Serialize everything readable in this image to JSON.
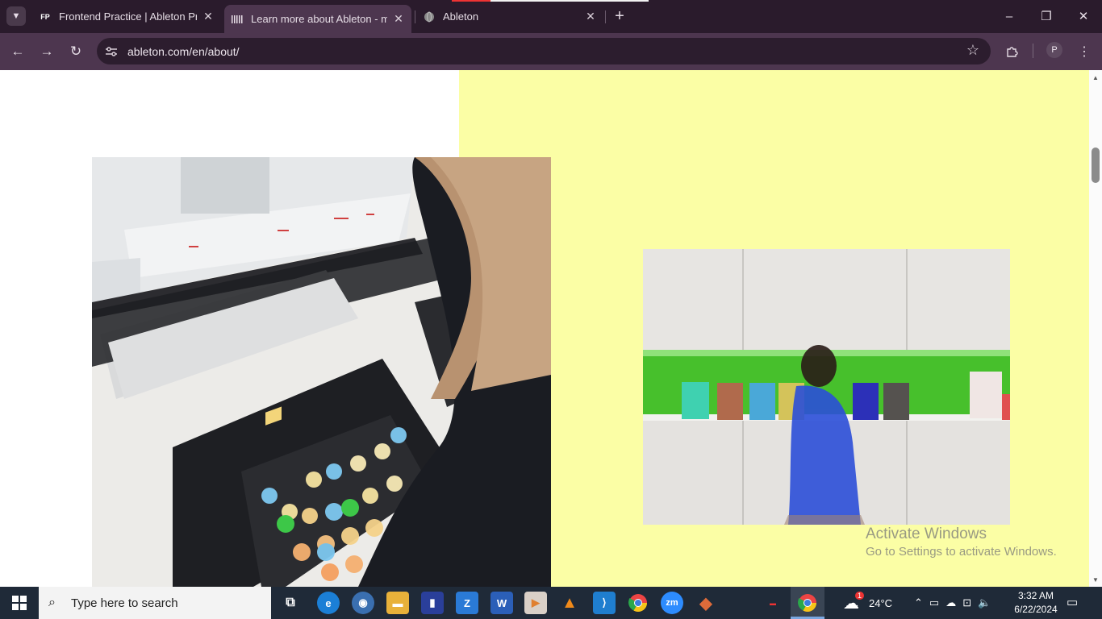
{
  "browser": {
    "tab_search_icon": "chevron-down-icon",
    "tabs": [
      {
        "title": "Frontend Practice | Ableton Pro",
        "favicon": "FP",
        "active": false
      },
      {
        "title": "Learn more about Ableton - ma",
        "favicon": "ableton-logo-icon",
        "active": true
      },
      {
        "title": "Ableton",
        "favicon": "globe-icon",
        "active": false
      }
    ],
    "new_tab_label": "+",
    "window_controls": {
      "minimize": "–",
      "restore": "❐",
      "close": "✕"
    },
    "url": "ableton.com/en/about/",
    "profile_initial": "P"
  },
  "page": {
    "yellow_color": "#fbfea5",
    "left_image_alt": "Person playing Ableton Push controller at a desk with computer",
    "right_image_alt": "Person walking past green bookshelf with Ableton books"
  },
  "watermark": {
    "line1": "Activate Windows",
    "line2": "Go to Settings to activate Windows."
  },
  "taskbar": {
    "search_placeholder": "Type here to search",
    "weather_temp": "24°C",
    "weather_badge": "1",
    "time": "3:32 AM",
    "date": "6/22/2024",
    "apps": [
      {
        "name": "task-view",
        "glyph": "⧉",
        "color": "#1f2a38"
      },
      {
        "name": "edge",
        "glyph": "e",
        "color": "#1b7fd6"
      },
      {
        "name": "media",
        "glyph": "◉",
        "color": "#3a6fb0"
      },
      {
        "name": "file-explorer",
        "glyph": "▬",
        "color": "#e8b13a"
      },
      {
        "name": "app-blue",
        "glyph": "▮",
        "color": "#2a3f9a"
      },
      {
        "name": "app-z",
        "glyph": "Z",
        "color": "#2a7ad6"
      },
      {
        "name": "word",
        "glyph": "W",
        "color": "#2b5fb8"
      },
      {
        "name": "video",
        "glyph": "▶",
        "color": "#d9d0c8"
      },
      {
        "name": "vlc",
        "glyph": "▲",
        "color": "#f08a1a"
      },
      {
        "name": "vscode",
        "glyph": "⟩",
        "color": "#1f7ecf"
      },
      {
        "name": "chrome",
        "glyph": "●",
        "color": "#e44"
      },
      {
        "name": "zoom",
        "glyph": "zm",
        "color": "#2d8cff"
      },
      {
        "name": "git-tool",
        "glyph": "◆",
        "color": "#dd6b3a"
      }
    ]
  }
}
